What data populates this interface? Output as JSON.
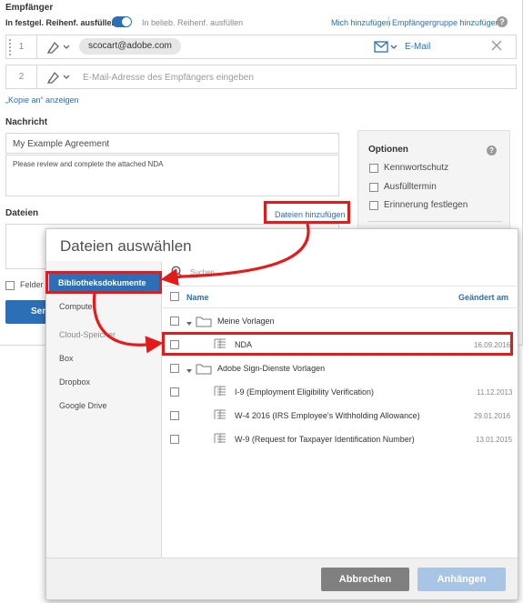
{
  "recipients": {
    "title": "Empfänger",
    "order_fixed_label": "In festgel. Reihenf. ausfüllen",
    "order_any_label": "In belieb. Reihenf. ausfüllen",
    "add_me_link": "Mich hinzufügen",
    "add_group_link": "Empfängergruppe hinzufügen",
    "rows": [
      {
        "num": "1",
        "email": "scocart@adobe.com",
        "method": "E-Mail"
      },
      {
        "num": "2",
        "placeholder": "E-Mail-Adresse des Empfängers eingeben"
      }
    ],
    "cc_link": "„Kopie an“ anzeigen"
  },
  "message": {
    "title": "Nachricht",
    "agreement_name": "My Example Agreement",
    "body": "Please review and complete the attached NDA"
  },
  "options": {
    "title": "Optionen",
    "items": [
      "Kennwortschutz",
      "Ausfülltermin",
      "Erinnerung festlegen"
    ]
  },
  "files": {
    "title": "Dateien",
    "add_files_link": "Dateien hinzufügen"
  },
  "background_partial": {
    "fields_label": "Felder",
    "send_button_partial": "Sen"
  },
  "dialog": {
    "title": "Dateien auswählen",
    "sidebar": {
      "selected": "Bibliotheksdokumente",
      "computer": "Computer",
      "cloud_heading": "Cloud-Speicher",
      "cloud_items": [
        "Box",
        "Dropbox",
        "Google Drive"
      ]
    },
    "search_placeholder": "Suchen",
    "columns": {
      "name": "Name",
      "changed": "Geändert am"
    },
    "rows": [
      {
        "type": "folder",
        "name": "Meine Vorlagen",
        "date": ""
      },
      {
        "type": "doc",
        "name": "NDA",
        "date": "16.09.2016"
      },
      {
        "type": "folder",
        "name": "Adobe Sign-Dienste Vorlagen",
        "date": ""
      },
      {
        "type": "doc",
        "name": "I-9 (Employment Eligibility Verification)",
        "date": "11.12.2013"
      },
      {
        "type": "doc",
        "name": "W-4 2016 (IRS Employee's Withholding Allowance)",
        "date": "29.01.2016"
      },
      {
        "type": "doc",
        "name": "W-9 (Request for Taxpayer Identification Number)",
        "date": "13.01.2015"
      }
    ],
    "cancel_button": "Abbrechen",
    "add_button": "Anhängen"
  },
  "colors": {
    "accent": "#2d6fb6",
    "annotation_red": "#e41b1b",
    "cancel_button_bg": "#808080",
    "add_button_bg": "#a9c5e6"
  }
}
